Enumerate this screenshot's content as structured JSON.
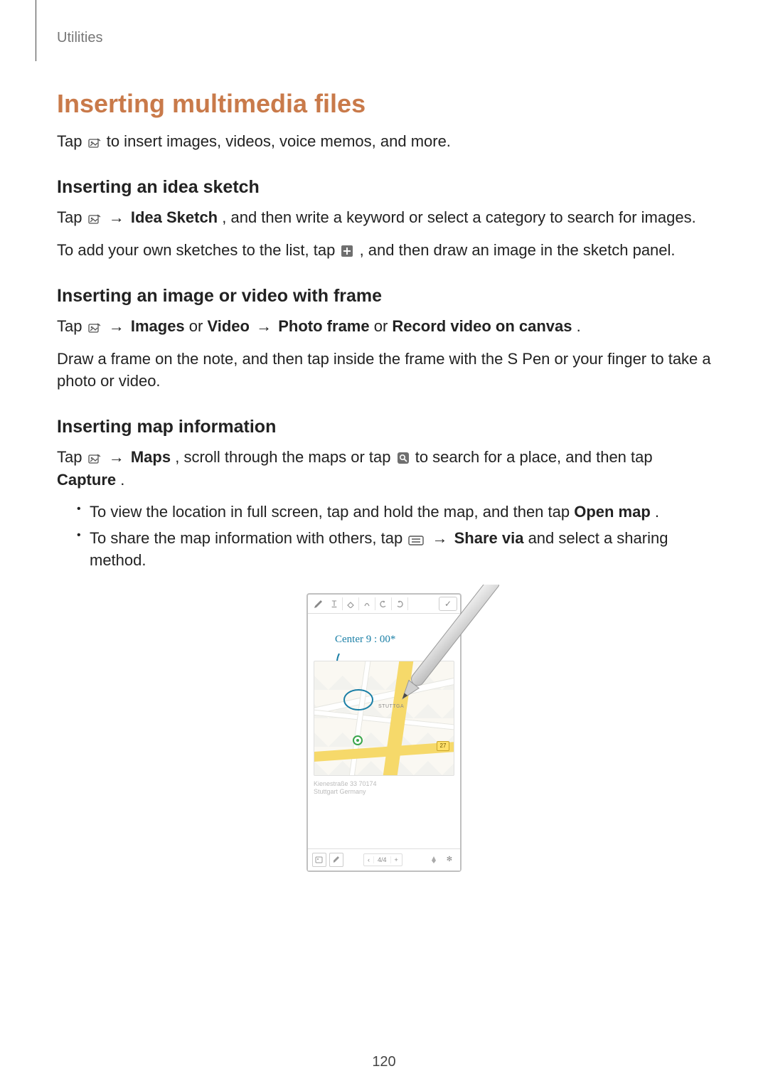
{
  "running_head": "Utilities",
  "page_number": "120",
  "section": {
    "title": "Inserting multimedia files",
    "intro_before": "Tap ",
    "intro_after": " to insert images, videos, voice memos, and more."
  },
  "sub1": {
    "title": "Inserting an idea sketch",
    "p1": {
      "before": "Tap ",
      "arrow": " → ",
      "bold": "Idea Sketch",
      "after": ", and then write a keyword or select a category to search for images."
    },
    "p2": {
      "before": "To add your own sketches to the list, tap ",
      "after": ", and then draw an image in the sketch panel."
    }
  },
  "sub2": {
    "title": "Inserting an image or video with frame",
    "p1": {
      "before": "Tap ",
      "arrow1": " → ",
      "b1": "Images",
      "or1": " or ",
      "b2": "Video",
      "arrow2": " → ",
      "b3": "Photo frame",
      "or2": " or ",
      "b4": "Record video on canvas",
      "period": "."
    },
    "p2": "Draw a frame on the note, and then tap inside the frame with the S Pen or your finger to take a photo or video."
  },
  "sub3": {
    "title": "Inserting map information",
    "p1": {
      "before": "Tap ",
      "arrow": " → ",
      "b1": "Maps",
      "mid1": ", scroll through the maps or tap ",
      "mid2": " to search for a place, and then tap ",
      "b2": "Capture",
      "period": "."
    },
    "li1": {
      "before": "To view the location in full screen, tap and hold the map, and then tap ",
      "b": "Open map",
      "after": "."
    },
    "li2": {
      "before": "To share the map information with others, tap ",
      "arrow": " → ",
      "b": "Share via",
      "after": " and select a sharing method."
    }
  },
  "mock": {
    "handwriting": "Center   9 : 00*",
    "address_line1": "Kienestraße 33 70174",
    "address_line2": "Stuttgart Germany",
    "map_label": "STUTTGA",
    "map_badge": "27",
    "pager_prev": "‹",
    "pager_pos": "4/4",
    "pager_add": "+"
  },
  "icons": {
    "attach": "attach-icon",
    "plus": "plus-icon",
    "search": "search-icon",
    "menu": "menu-icon"
  }
}
